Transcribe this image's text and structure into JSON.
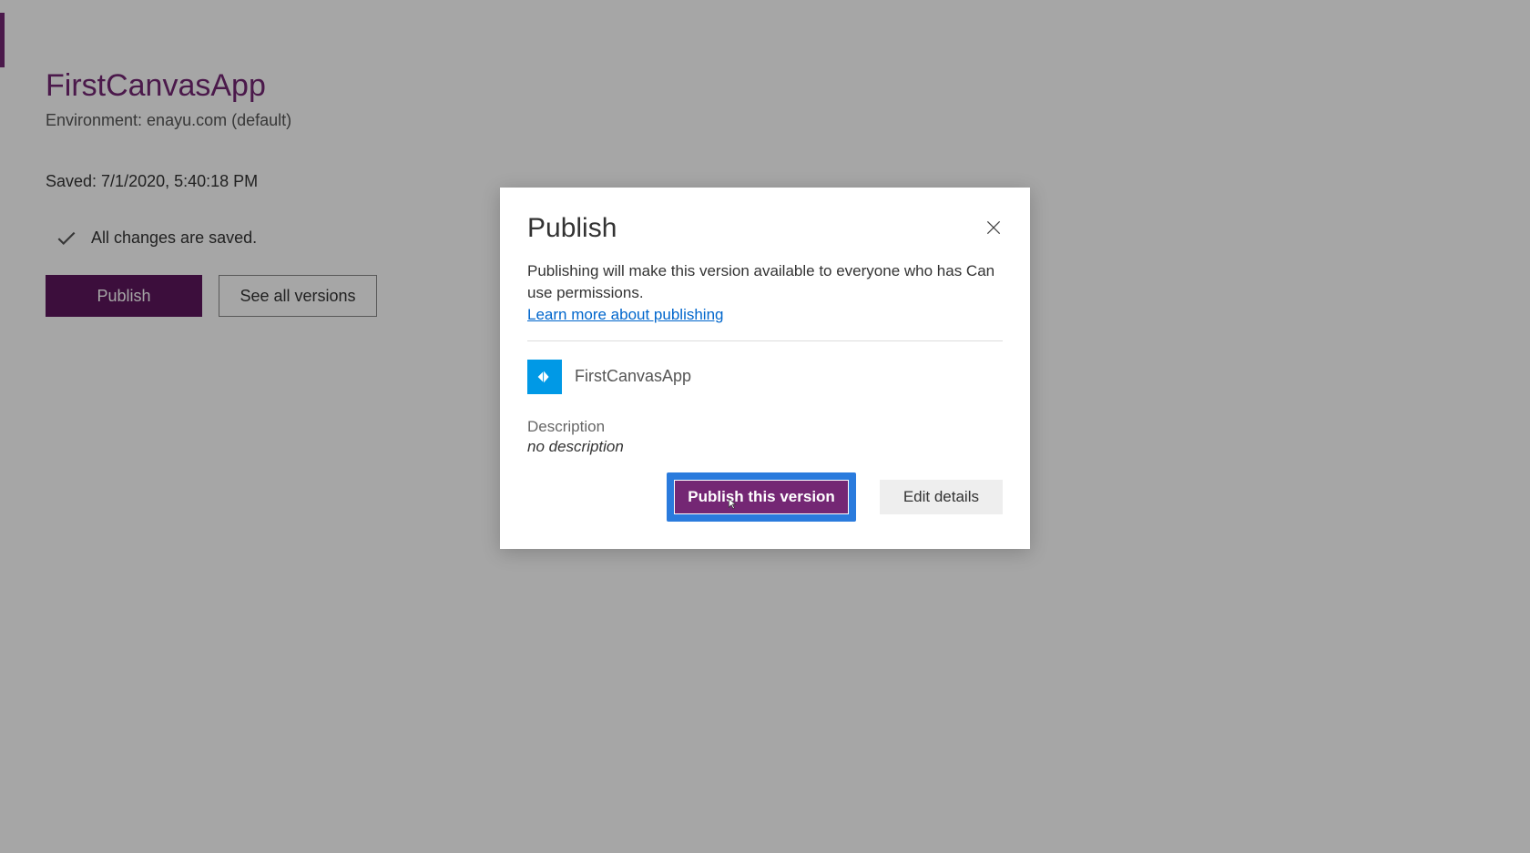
{
  "page": {
    "app_title": "FirstCanvasApp",
    "environment": "Environment: enayu.com (default)",
    "saved_info": "Saved: 7/1/2020, 5:40:18 PM",
    "status_text": "All changes are saved.",
    "publish_button": "Publish",
    "see_all_versions_button": "See all versions"
  },
  "modal": {
    "title": "Publish",
    "description": "Publishing will make this version available to everyone who has Can use permissions.",
    "learn_more_link": "Learn more about publishing",
    "app_name": "FirstCanvasApp",
    "description_label": "Description",
    "description_value": "no description",
    "publish_version_button": "Publish this version",
    "edit_details_button": "Edit details"
  }
}
